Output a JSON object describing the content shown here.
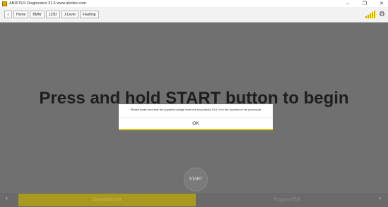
{
  "window": {
    "title": "ABRITES Diagnostics 31.6  www.abrites.com",
    "controls": {
      "minimize": "–",
      "maximize": "❐",
      "close": "✕"
    }
  },
  "toolbar": {
    "back_label": "‹",
    "breadcrumb": [
      "Home",
      "BMW",
      "123D",
      "J-Level",
      "Flashing"
    ],
    "icons": [
      "signal-strength-icon",
      "gear-icon"
    ],
    "accent_color": "#d4b000"
  },
  "main": {
    "headline": "Press and hold START button to begin",
    "start_label": "START",
    "small_label": "·····"
  },
  "steps": {
    "prev_arrow": "‹",
    "next_arrow": "›",
    "items": [
      "Download data",
      "Program FEM"
    ],
    "active_index": 0
  },
  "dialog": {
    "message": "Please make sure that the supplied voltage does not drop below 13.6 V for the duration of the procedure",
    "ok_label": "OK"
  }
}
